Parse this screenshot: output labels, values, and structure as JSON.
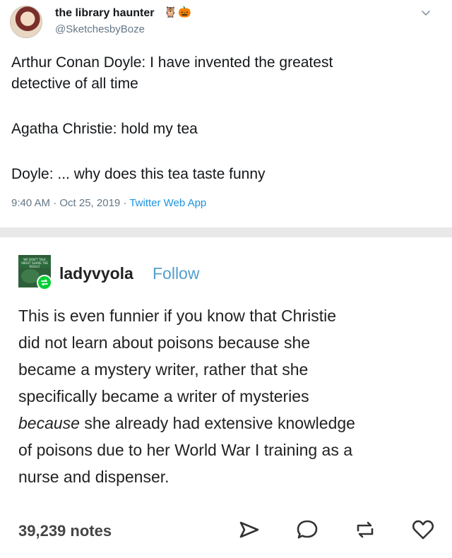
{
  "tweet": {
    "display_name": "the library haunter",
    "name_emojis": [
      "🦉",
      "🎃"
    ],
    "handle": "@SketchesbyBoze",
    "lines": [
      "Arthur Conan Doyle: I have invented the greatest",
      "detective of all time",
      "Agatha Christie: hold my tea",
      "Doyle: ... why does this tea taste funny"
    ],
    "timestamp": "9:40 AM · Oct 25, 2019 · ",
    "source_app": "Twitter Web App",
    "menu_icon": "chevron-down-icon",
    "link_color": "#1b95e0"
  },
  "post": {
    "username": "ladyvyola",
    "follow_label": "Follow",
    "avatar_text": "WE DON'T TALK ABOUT SHARE THE RESULT",
    "body_lines": [
      {
        "pre": "This is even funnier if you know that Christie",
        "em": "",
        "post": ""
      },
      {
        "pre": "did not learn about poisons because she",
        "em": "",
        "post": ""
      },
      {
        "pre": "became a mystery writer, rather that she",
        "em": "",
        "post": ""
      },
      {
        "pre": "specifically became a writer of mysteries",
        "em": "",
        "post": ""
      },
      {
        "pre": "",
        "em": "because",
        "post": " she already had extensive knowledge"
      },
      {
        "pre": "of poisons due to her World War I training as a",
        "em": "",
        "post": ""
      },
      {
        "pre": "nurse and dispenser.",
        "em": "",
        "post": ""
      }
    ],
    "notes": "39,239 notes",
    "actions": [
      "share-icon",
      "reply-icon",
      "reblog-icon",
      "like-icon"
    ],
    "follow_color": "#529ecc",
    "reblog_color": "#00cf35"
  }
}
